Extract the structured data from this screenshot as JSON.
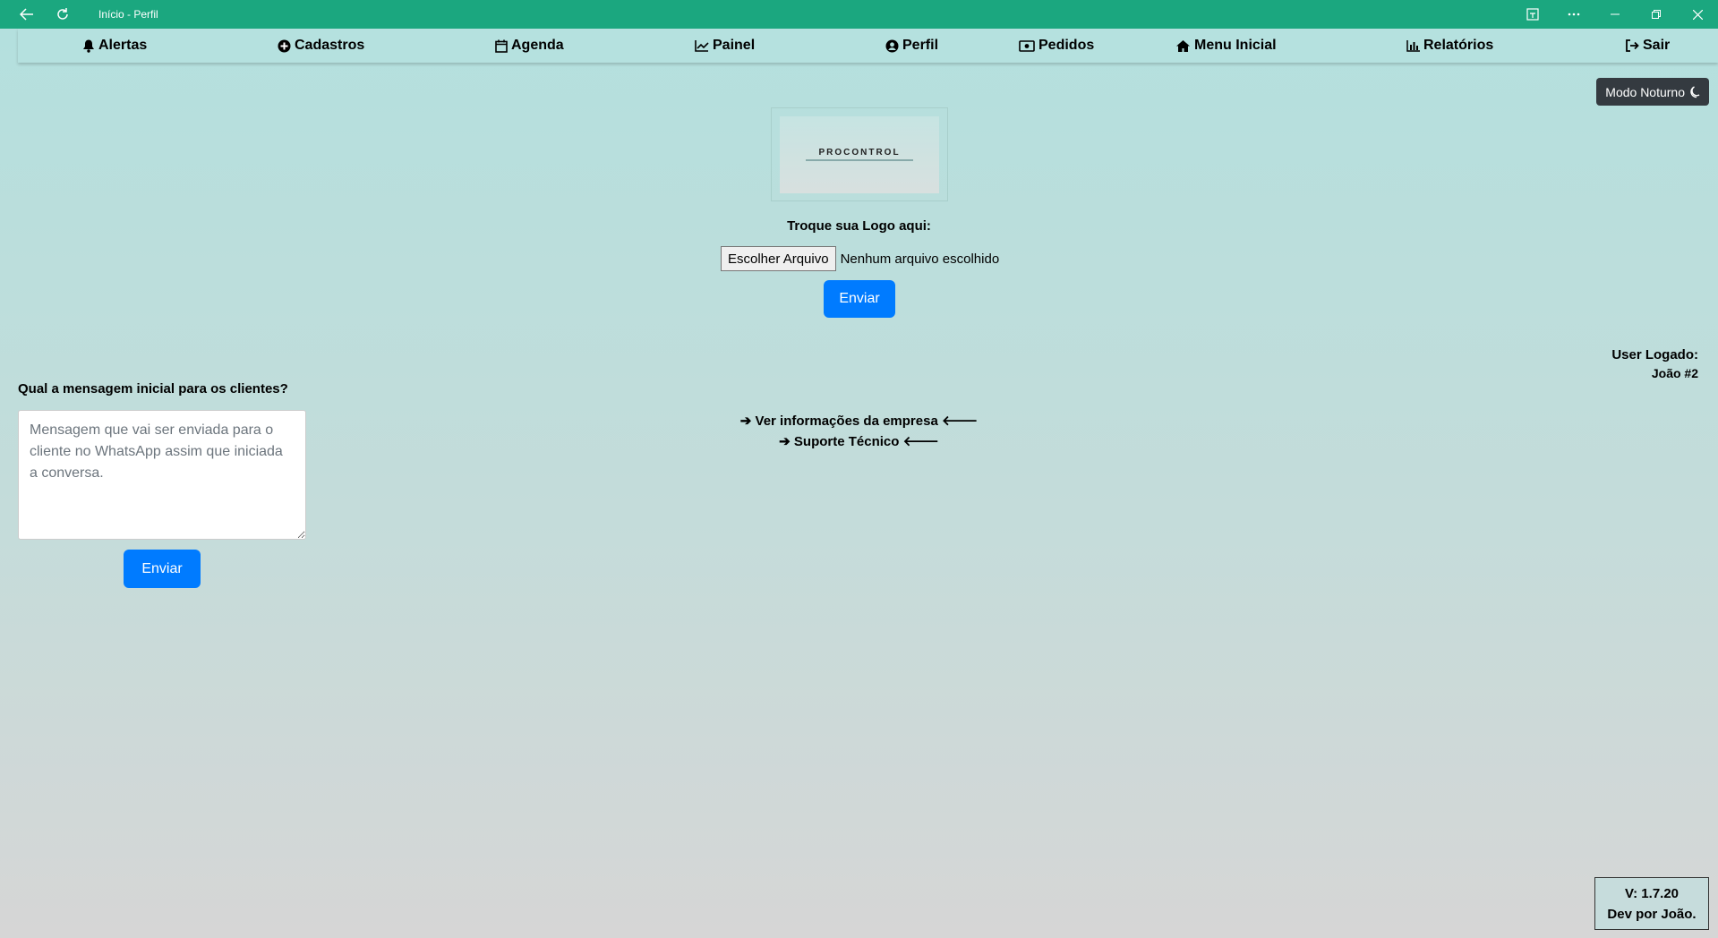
{
  "window": {
    "title": "Início - Perfil"
  },
  "nav": {
    "items": [
      {
        "label": "Alertas",
        "icon": "bell-icon"
      },
      {
        "label": "Cadastros",
        "icon": "plus-circle-icon"
      },
      {
        "label": "Agenda",
        "icon": "calendar-icon"
      },
      {
        "label": "Painel",
        "icon": "chart-line-icon"
      },
      {
        "label": "Perfil",
        "icon": "user-circle-icon"
      },
      {
        "label": "Pedidos",
        "icon": "money-bill-icon"
      },
      {
        "label": "Menu Inicial",
        "icon": "home-icon"
      },
      {
        "label": "Relatórios",
        "icon": "bar-chart-icon"
      },
      {
        "label": "Sair",
        "icon": "sign-out-icon"
      }
    ]
  },
  "night_mode": {
    "label": "Modo Noturno"
  },
  "logo": {
    "brand_text": "PROCONTROL",
    "change_label": "Troque sua Logo aqui:",
    "choose_file": "Escolher Arquivo",
    "file_status": "Nenhum arquivo escolhido",
    "send_label": "Enviar"
  },
  "user": {
    "label": "User Logado:",
    "name": "João #2"
  },
  "links": {
    "company_info": "➔ Ver informações da empresa 🡐",
    "support": "➔ Suporte Técnico 🡐"
  },
  "message": {
    "label": "Qual a mensagem inicial para os clientes?",
    "placeholder": "Mensagem que vai ser enviada para o cliente no WhatsApp assim que iniciada a conversa.",
    "send_label": "Enviar"
  },
  "footer": {
    "version": "V: 1.7.20",
    "dev": "Dev por João."
  },
  "colors": {
    "titlebar": "#1ba77f",
    "primary": "#007bff",
    "dark": "#343a40"
  }
}
